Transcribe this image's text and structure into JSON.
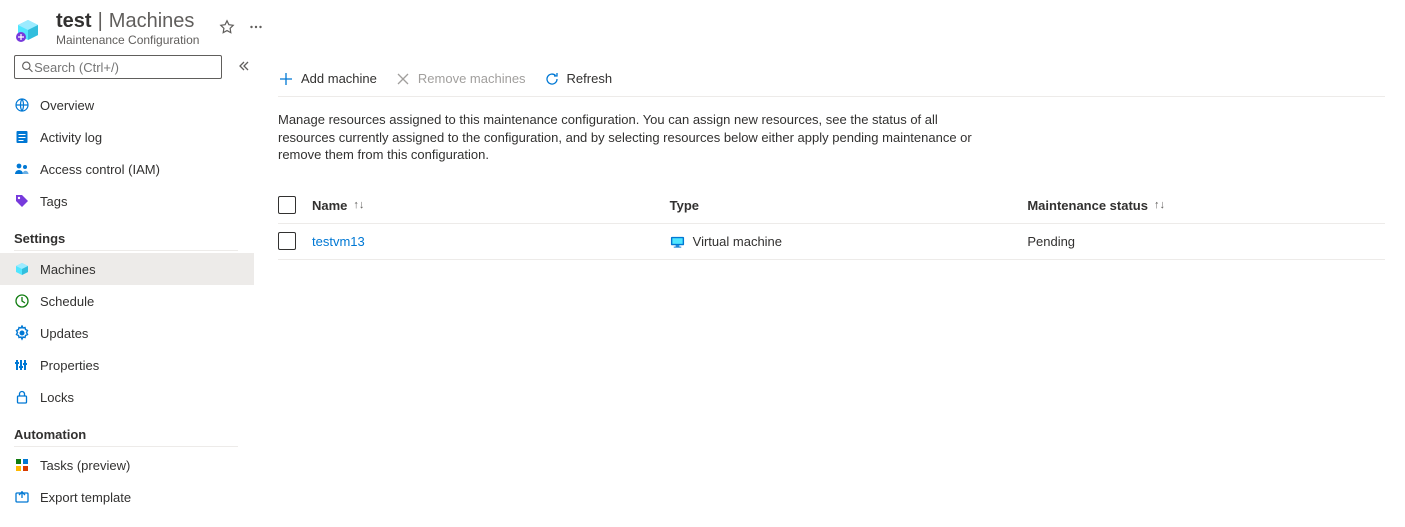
{
  "header": {
    "resource_name": "test",
    "section": "Machines",
    "subtitle": "Maintenance Configuration"
  },
  "search": {
    "placeholder": "Search (Ctrl+/)"
  },
  "sidebar": {
    "groups": [
      {
        "heading": null,
        "items": [
          {
            "id": "overview",
            "label": "Overview"
          },
          {
            "id": "activitylog",
            "label": "Activity log"
          },
          {
            "id": "iam",
            "label": "Access control (IAM)"
          },
          {
            "id": "tags",
            "label": "Tags"
          }
        ]
      },
      {
        "heading": "Settings",
        "items": [
          {
            "id": "machines",
            "label": "Machines",
            "selected": true
          },
          {
            "id": "schedule",
            "label": "Schedule"
          },
          {
            "id": "updates",
            "label": "Updates"
          },
          {
            "id": "properties",
            "label": "Properties"
          },
          {
            "id": "locks",
            "label": "Locks"
          }
        ]
      },
      {
        "heading": "Automation",
        "items": [
          {
            "id": "tasks",
            "label": "Tasks (preview)"
          },
          {
            "id": "export",
            "label": "Export template"
          }
        ]
      }
    ]
  },
  "toolbar": {
    "add": "Add machine",
    "remove": "Remove machines",
    "refresh": "Refresh"
  },
  "description": "Manage resources assigned to this maintenance configuration. You can assign new resources, see the status of all resources currently assigned to the configuration, and by selecting resources below either apply pending maintenance or remove them from this configuration.",
  "table": {
    "columns": {
      "name": "Name",
      "type": "Type",
      "status": "Maintenance status"
    },
    "rows": [
      {
        "name": "testvm13",
        "type": "Virtual machine",
        "status": "Pending"
      }
    ]
  }
}
